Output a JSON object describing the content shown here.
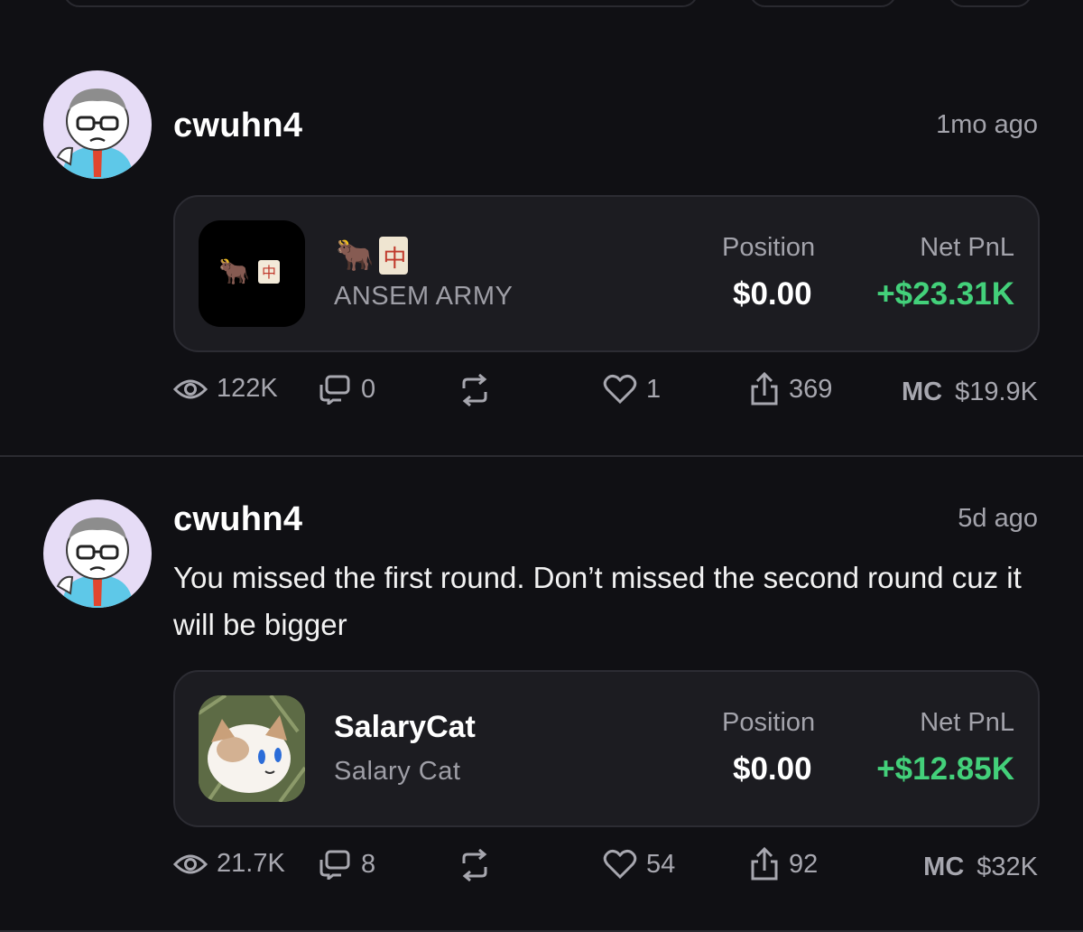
{
  "posts": [
    {
      "username": "cwuhn4",
      "time": "1mo ago",
      "message": "",
      "token": {
        "name_emoji": [
          "🐂",
          "🀄"
        ],
        "subtitle": "ANSEM ARMY",
        "position_label": "Position",
        "position_value": "$0.00",
        "pnl_label": "Net PnL",
        "pnl_value": "+$23.31K"
      },
      "metrics": {
        "views": "122K",
        "comments": "0",
        "likes": "1",
        "shares": "369",
        "mc_label": "MC",
        "mc_value": "$19.9K"
      }
    },
    {
      "username": "cwuhn4",
      "time": "5d ago",
      "message": "You missed the first round. Don’t missed the second round cuz it will be bigger",
      "token": {
        "name": "SalaryCat",
        "subtitle": "Salary Cat",
        "position_label": "Position",
        "position_value": "$0.00",
        "pnl_label": "Net PnL",
        "pnl_value": "+$12.85K"
      },
      "metrics": {
        "views": "21.7K",
        "comments": "8",
        "likes": "54",
        "shares": "92",
        "mc_label": "MC",
        "mc_value": "$32K"
      }
    }
  ],
  "colors": {
    "background": "#101014",
    "card": "#1c1c21",
    "positive": "#43d07a",
    "muted": "#a3a3ab"
  },
  "icons": [
    "eye-icon",
    "comment-icon",
    "repost-icon",
    "heart-icon",
    "share-icon"
  ]
}
